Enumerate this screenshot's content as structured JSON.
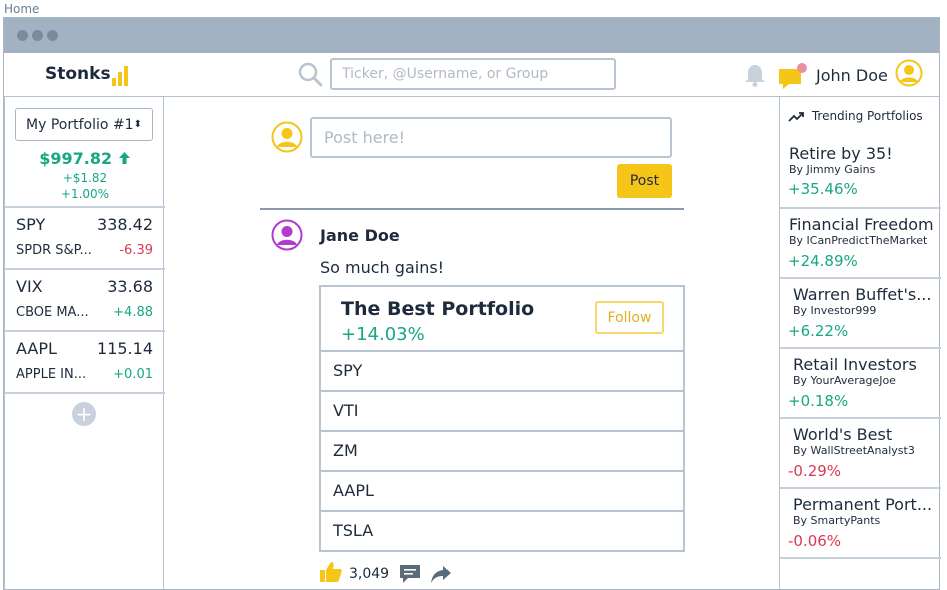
{
  "browser": {
    "tab_label": "Home"
  },
  "header": {
    "brand": "Stonks",
    "search_placeholder": "Ticker, @Username, or Group",
    "user_name": "John Doe",
    "accent_color": "#f5c518"
  },
  "portfolio": {
    "selected": "My Portfolio #1",
    "value": "$997.82",
    "change_abs": "+$1.82",
    "change_pct": "+1.00%"
  },
  "watchlist": [
    {
      "symbol": "SPY",
      "price": "338.42",
      "name": "SPDR S&P...",
      "change": "-6.39",
      "direction": "down"
    },
    {
      "symbol": "VIX",
      "price": "33.68",
      "name": "CBOE MA...",
      "change": "+4.88",
      "direction": "up"
    },
    {
      "symbol": "AAPL",
      "price": "115.14",
      "name": "APPLE IN...",
      "change": "+0.01",
      "direction": "up"
    }
  ],
  "composer": {
    "placeholder": "Post here!",
    "post_label": "Post"
  },
  "post": {
    "author": "Jane Doe",
    "text": "So much gains!",
    "card": {
      "title": "The Best Portfolio",
      "gain": "+14.03%",
      "follow_label": "Follow",
      "holdings": [
        "SPY",
        "VTI",
        "ZM",
        "AAPL",
        "TSLA"
      ]
    },
    "likes": "3,049"
  },
  "trending": {
    "heading": "Trending Portfolios",
    "items": [
      {
        "title": "Retire by 35!",
        "by": "By Jimmy Gains",
        "gain": "+35.46%",
        "direction": "up"
      },
      {
        "title": "Financial Freedom",
        "by": "By ICanPredictTheMarket",
        "gain": "+24.89%",
        "direction": "up"
      },
      {
        "title": "Warren Buffet's...",
        "by": "By Investor999",
        "gain": "+6.22%",
        "direction": "up"
      },
      {
        "title": "Retail Investors",
        "by": "By YourAverageJoe",
        "gain": "+0.18%",
        "direction": "up"
      },
      {
        "title": "World's Best",
        "by": "By WallStreetAnalyst3",
        "gain": "-0.29%",
        "direction": "down"
      },
      {
        "title": "Permanent Port...",
        "by": "By SmartyPants",
        "gain": "-0.06%",
        "direction": "down"
      }
    ]
  }
}
